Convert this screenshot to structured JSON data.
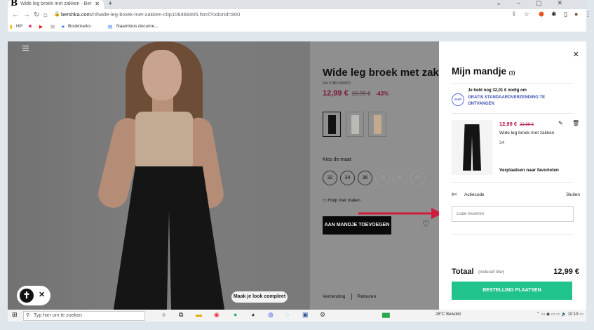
{
  "browser": {
    "tab_title": "Wide leg broek met zakken - Ber",
    "url_domain": "bershka.com",
    "url_path": "/nl/wide-leg-broek-met-zakken-c0p106468405.html?colorId=800",
    "bookmarks": [
      "HP",
      "Bookmarks",
      "Naamloos docume..."
    ]
  },
  "product": {
    "title": "Wide leg broek met zakken",
    "ref": "Ref 0786/168/800",
    "price": "12,99 €",
    "old_price": "22,99 €",
    "discount": "-43%",
    "size_label": "Kies de maat",
    "sizes": [
      "32",
      "34",
      "36",
      "38",
      "40",
      "42"
    ],
    "guide": "Hulp met maten",
    "add_button": "AAN MANDJE TOEVOEGEN",
    "look_button": "Maak je look compleet",
    "links": [
      "Verzending",
      "Retouren"
    ]
  },
  "cart": {
    "title": "Mijn mandje",
    "count": "(1)",
    "shipping_line1": "Je hebt nog 32,01 € nodig om",
    "shipping_line2": "GRATIS STANDAARDVERZENDING TE ONTVANGEN",
    "shipping_icon": "SHIP",
    "item_price": "12,99 €",
    "item_old_price": "22,99 €",
    "item_name": "Wide leg broek met zakken",
    "item_size": "34",
    "move_fav": "Verplaatsen naar favorieten",
    "action_label": "Actiecode",
    "close_label": "Sluiten",
    "code_placeholder": "Code invoeren",
    "total_label": "Totaal",
    "total_incl": "(inclusief btw)",
    "total_value": "12,99 €",
    "checkout": "BESTELLING PLAATSEN"
  },
  "taskbar": {
    "search_placeholder": "Typ hier om te zoeken",
    "weather": "28°C  Bewolkt",
    "time": "10:19"
  },
  "colors": {
    "accent_green": "#20c38b",
    "price_red": "#b3134a",
    "arrow_red": "#d01c3c"
  }
}
